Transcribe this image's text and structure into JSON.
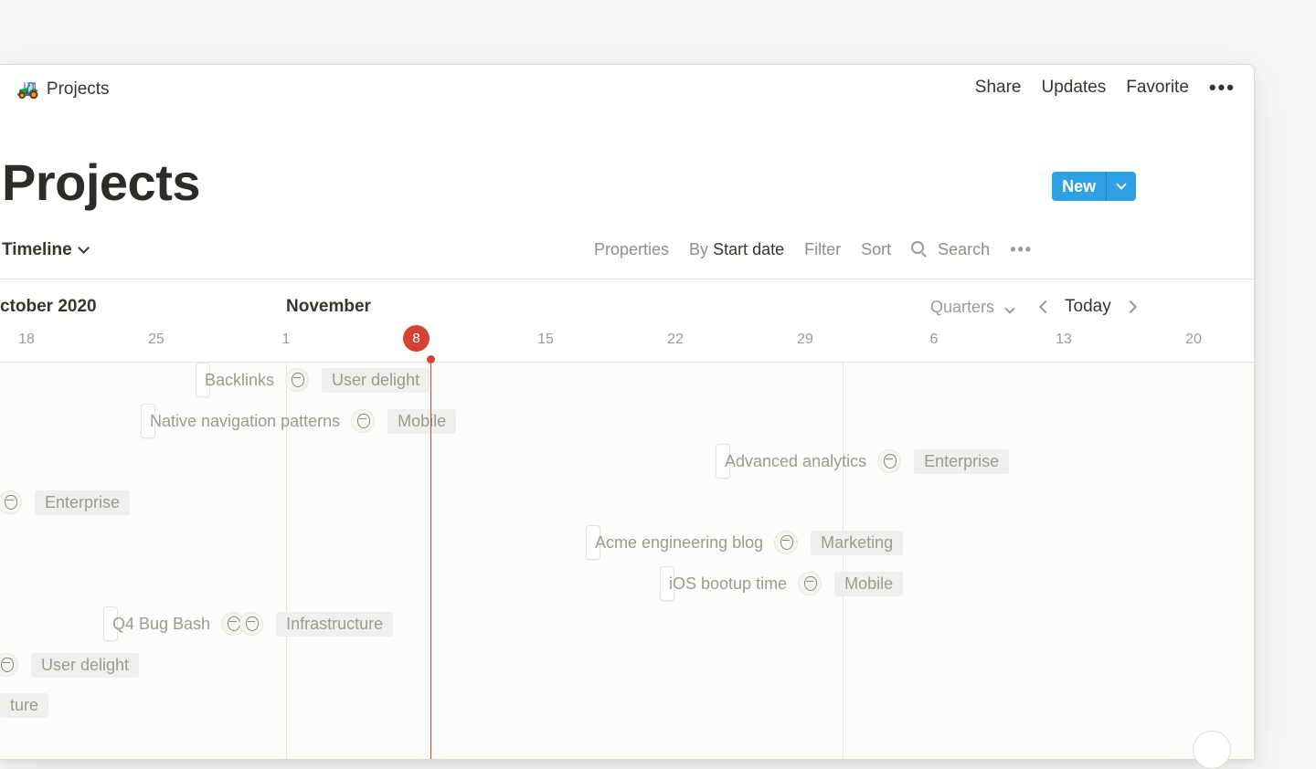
{
  "topbar": {
    "emoji": "🚜",
    "breadcrumb": "Projects",
    "share": "Share",
    "updates": "Updates",
    "favorite": "Favorite",
    "more": "•••"
  },
  "page": {
    "title": "Projects"
  },
  "viewbar": {
    "view_name": "Timeline",
    "properties": "Properties",
    "by_prefix": "By",
    "by_value": "Start date",
    "filter": "Filter",
    "sort": "Sort",
    "search": "Search",
    "more": "•••",
    "new": "New"
  },
  "timeline": {
    "month_left": "ctober 2020",
    "month_right": "November",
    "period": "Quarters",
    "today": "Today",
    "today_day": "8",
    "days": [
      "18",
      "25",
      "1",
      "15",
      "22",
      "29",
      "6",
      "13",
      "20"
    ]
  },
  "rows": [
    {
      "name": "Backlinks",
      "tag": "User delight"
    },
    {
      "name": "Native navigation patterns",
      "tag": "Mobile"
    },
    {
      "name": "Advanced analytics",
      "tag": "Enterprise"
    },
    {
      "name": "",
      "tag": "Enterprise"
    },
    {
      "name": "Acme engineering blog",
      "tag": "Marketing"
    },
    {
      "name": "iOS bootup time",
      "tag": "Mobile"
    },
    {
      "name": "Q4 Bug Bash",
      "tag": "Infrastructure"
    },
    {
      "name": "",
      "tag": "User delight"
    },
    {
      "name": "",
      "tag": "ture"
    }
  ],
  "colors": {
    "accent_blue": "#2ea0e3",
    "today_red": "#d44333",
    "text": "#37352f",
    "muted": "#9b9a97"
  }
}
